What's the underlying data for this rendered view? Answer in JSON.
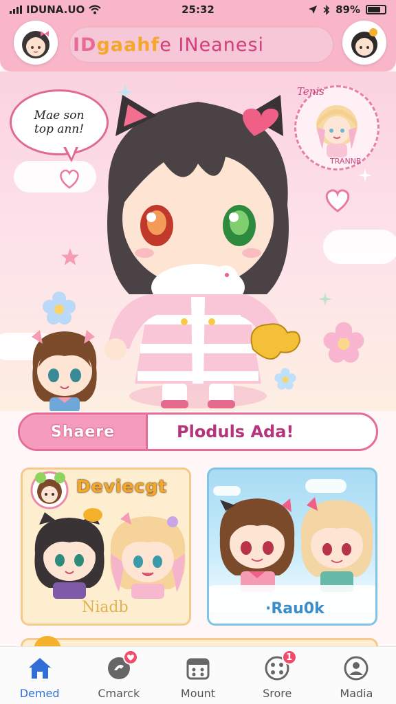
{
  "status_bar": {
    "carrier": "IDUNA.UO",
    "time": "25:32",
    "battery": "89%"
  },
  "header": {
    "title_part1": "ID ",
    "title_part2": "gaahf",
    "title_part3": "e INeanesi"
  },
  "hero": {
    "speech_line1": "Mae son",
    "speech_line2": "top ann!",
    "frame_top_text": "Tenis",
    "frame_bottom_text": "TRANNB"
  },
  "share_bar": {
    "button_label": "Shaere",
    "text": "Ploduls Ada!"
  },
  "cards": [
    {
      "title": "Deviecgt",
      "footer": "Niadb"
    },
    {
      "title": "",
      "footer": "·Rau0k"
    }
  ],
  "tabbar": {
    "items": [
      {
        "label": "Demed",
        "icon": "home-icon",
        "active": true
      },
      {
        "label": "Cmarck",
        "icon": "chat-icon",
        "badge": ""
      },
      {
        "label": "Mount",
        "icon": "calendar-icon"
      },
      {
        "label": "Srore",
        "icon": "store-icon",
        "badge": "1"
      },
      {
        "label": "Madia",
        "icon": "profile-icon"
      }
    ]
  },
  "colors": {
    "header_pink": "#f9b6c9",
    "accent_pink": "#e46c98",
    "tab_active": "#2f6fd6",
    "badge_red": "#ef4d6b"
  }
}
